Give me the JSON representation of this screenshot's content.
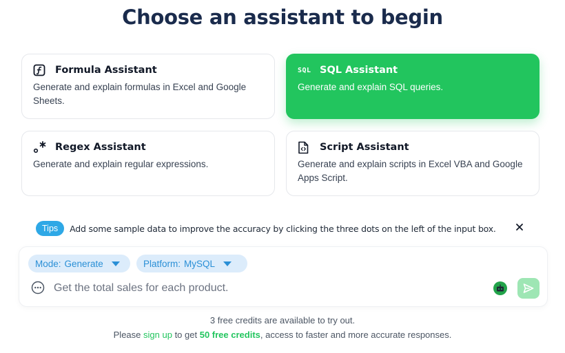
{
  "page": {
    "title": "Choose an assistant to begin"
  },
  "assistants": [
    {
      "name": "Formula Assistant",
      "description": "Generate and explain formulas in Excel and Google Sheets.",
      "icon": "function-icon",
      "active": false
    },
    {
      "name": "SQL Assistant",
      "description": "Generate and explain SQL queries.",
      "icon": "sql-icon",
      "icon_text": "SQL",
      "active": true
    },
    {
      "name": "Regex Assistant",
      "description": "Generate and explain regular expressions.",
      "icon": "regex-icon",
      "active": false
    },
    {
      "name": "Script Assistant",
      "description": "Generate and explain scripts in Excel VBA and Google Apps Script.",
      "icon": "script-file-icon",
      "active": false
    }
  ],
  "tips": {
    "badge": "Tips",
    "text": "Add some sample data to improve the accuracy by clicking the three dots on the left of the input box."
  },
  "input": {
    "mode_label": "Mode:",
    "mode_value": "Generate",
    "platform_label": "Platform:",
    "platform_value": "MySQL",
    "placeholder": "Get the total sales for each product."
  },
  "footer": {
    "credits_line": "3 free credits are available to try out.",
    "prefix": "Please",
    "signup_link": "sign up",
    "middle": "to get",
    "credits_highlight": "50 free credits",
    "suffix": ", access to faster and more accurate responses."
  },
  "colors": {
    "accent_green": "#22c55e",
    "tips_blue": "#2ea8e6",
    "pill_bg": "#dcecfb",
    "pill_text": "#2a8fd6",
    "title": "#1a2b4c"
  }
}
